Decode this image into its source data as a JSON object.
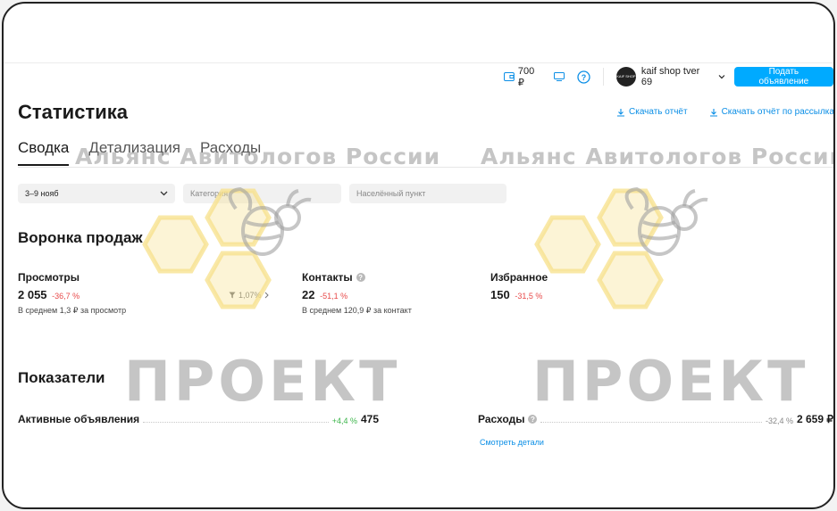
{
  "header": {
    "balance": "700 ₽",
    "user_name": "kaif shop tver 69",
    "avatar_text": "KAIF SHOP",
    "post_button": "Подать объявление"
  },
  "page": {
    "title": "Статистика",
    "download_report": "Скачать отчёт",
    "download_mailing_report": "Скачать отчёт по рассылкам"
  },
  "tabs": [
    {
      "label": "Сводка",
      "active": true
    },
    {
      "label": "Детализация",
      "active": false
    },
    {
      "label": "Расходы",
      "active": false
    }
  ],
  "filters": {
    "period": "3–9 нояб",
    "category_placeholder": "Категория",
    "city_placeholder": "Населённый пункт"
  },
  "funnel": {
    "title": "Воронка продаж",
    "views": {
      "label": "Просмотры",
      "value": "2 055",
      "delta": "-36,7 %",
      "note": "В среднем 1,3 ₽ за просмотр"
    },
    "conversion": "1,07%",
    "contacts": {
      "label": "Контакты",
      "value": "22",
      "delta": "-51,1 %",
      "note": "В среднем 120,9 ₽ за контакт"
    },
    "favorites": {
      "label": "Избранное",
      "value": "150",
      "delta": "-31,5 %"
    }
  },
  "indicators": {
    "title": "Показатели",
    "active_ads": {
      "label": "Активные объявления",
      "delta": "+4,4 %",
      "value": "475"
    },
    "expenses": {
      "label": "Расходы",
      "delta": "-32,4 %",
      "value": "2 659 ₽",
      "link": "Смотреть детали"
    }
  },
  "watermark": {
    "alliance": "Альянс Авитологов России",
    "project": "ПРОЕКТ"
  },
  "colors": {
    "accent": "#00aaff",
    "link": "#0a8ee6",
    "negative": "#e84a4a",
    "positive": "#3bb54a",
    "honeycomb": "#f7e08a"
  }
}
